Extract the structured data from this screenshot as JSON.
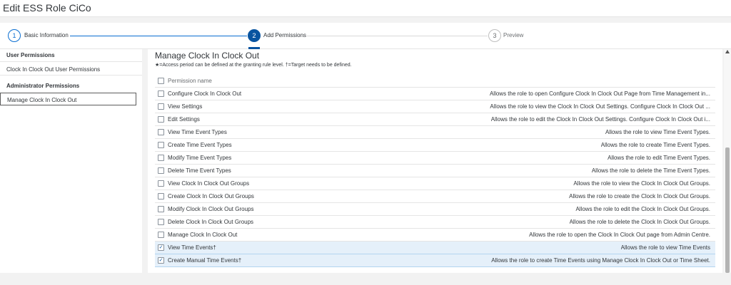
{
  "page": {
    "title": "Edit ESS Role CiCo"
  },
  "wizard": {
    "steps": [
      {
        "number": "1",
        "label": "Basic Information"
      },
      {
        "number": "2",
        "label": "Add Permissions"
      },
      {
        "number": "3",
        "label": "Preview"
      }
    ]
  },
  "sidebar": {
    "user_header": "User Permissions",
    "user_items": [
      "Clock In Clock Out User Permissions"
    ],
    "admin_header": "Administrator Permissions",
    "admin_items": [
      "Manage Clock In Clock Out"
    ]
  },
  "main": {
    "title": "Manage Clock In Clock Out",
    "subtitle": "★=Access period can be defined at the granting rule level.   †=Target needs to be defined.",
    "column_header": "Permission name",
    "rows": [
      {
        "name": "Configure Clock In Clock Out",
        "desc": "Allows the role to open Configure Clock In Clock Out Page from Time Management in...",
        "checked": false
      },
      {
        "name": "View Settings",
        "desc": "Allows the role to view the Clock In Clock Out Settings. Configure Clock In Clock Out ...",
        "checked": false
      },
      {
        "name": "Edit Settings",
        "desc": "Allows the role to edit the Clock In Clock Out Settings. Configure Clock In Clock Out i...",
        "checked": false
      },
      {
        "name": "View Time Event Types",
        "desc": "Allows the role to view Time Event Types.",
        "checked": false
      },
      {
        "name": "Create Time Event Types",
        "desc": "Allows the role to create Time Event Types.",
        "checked": false
      },
      {
        "name": "Modify Time Event Types",
        "desc": "Allows the role to edit Time Event Types.",
        "checked": false
      },
      {
        "name": "Delete Time Event Types",
        "desc": "Allows the role to delete the Time Event Types.",
        "checked": false
      },
      {
        "name": "View Clock In Clock Out Groups",
        "desc": "Allows the role to view the Clock In Clock Out Groups.",
        "checked": false
      },
      {
        "name": "Create Clock In Clock Out Groups",
        "desc": "Allows the role to create the Clock In Clock Out Groups.",
        "checked": false
      },
      {
        "name": "Modify Clock In Clock Out Groups",
        "desc": "Allows the role to edit the Clock In Clock Out Groups.",
        "checked": false
      },
      {
        "name": "Delete Clock In Clock Out Groups",
        "desc": "Allows the role to delete the Clock In Clock Out Groups.",
        "checked": false
      },
      {
        "name": "Manage Clock In Clock Out",
        "desc": "Allows the role to open the Clock In Clock Out page from Admin Centre.",
        "checked": false
      },
      {
        "name": "View Time Events†",
        "desc": "Allows the role to view Time Events",
        "checked": true
      },
      {
        "name": "Create Manual Time Events†",
        "desc": "Allows the role to create Time Events using Manage Clock In Clock Out or Time Sheet.",
        "checked": true
      }
    ]
  }
}
